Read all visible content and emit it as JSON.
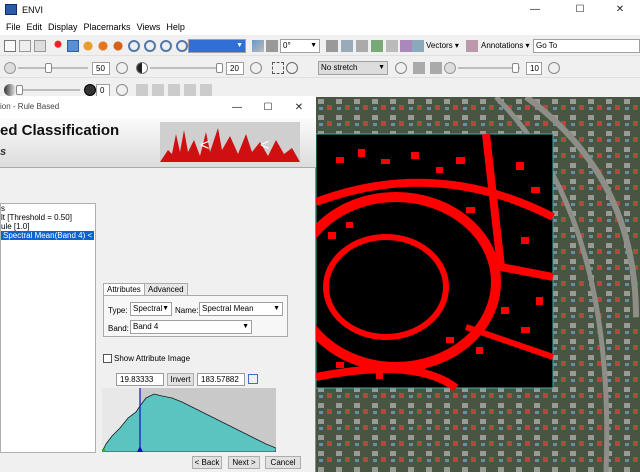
{
  "app": {
    "title": "ENVI",
    "icon": "envi-icon"
  },
  "window_controls": {
    "minimize": "—",
    "maximize": "☐",
    "close": "✕"
  },
  "menu": [
    "File",
    "Edit",
    "Display",
    "Placemarks",
    "Views",
    "Help"
  ],
  "toolbar1": {
    "zoom_value": "",
    "rotation_value": "0°",
    "vectors_label": "Vectors",
    "annotations_label": "Annotations",
    "goto_label": "Go To"
  },
  "toolbar2": {
    "brightness_value": "50",
    "contrast_value": "20",
    "stretch_value": "No stretch",
    "sharpen_value": "10"
  },
  "toolbar3": {
    "transparency_value": "0"
  },
  "dialog": {
    "title": "ion - Rule Based",
    "controls": {
      "minimize": "—",
      "maximize": "☐",
      "close": "✕"
    },
    "banner_title": "ed Classification",
    "banner_subtitle": "s",
    "tree": [
      {
        "label": "s",
        "selected": false
      },
      {
        "label": "lt [Threshold = 0.50]",
        "selected": false
      },
      {
        "label": "ule [1.0]",
        "selected": false
      },
      {
        "label": "Spectral Mean(Band 4) <",
        "selected": true
      }
    ],
    "tabs": [
      "Attributes",
      "Advanced"
    ],
    "type_label": "Type:",
    "type_value": "Spectral",
    "name_label": "Name:",
    "name_value": "Spectral Mean",
    "band_label": "Band:",
    "band_value": "Band 4",
    "show_attr_label": "Show Attribute Image",
    "threshold_low": "19.83333",
    "invert_label": "Invert",
    "threshold_high": "183.57882",
    "back_label": "< Back",
    "next_label": "Next >",
    "cancel_label": "Cancel"
  },
  "colors": {
    "classification": "#ff0000",
    "selection": "#0a64d2",
    "histogram_fill": "#5bc4c0",
    "image_bg": "#3e4a3b"
  }
}
